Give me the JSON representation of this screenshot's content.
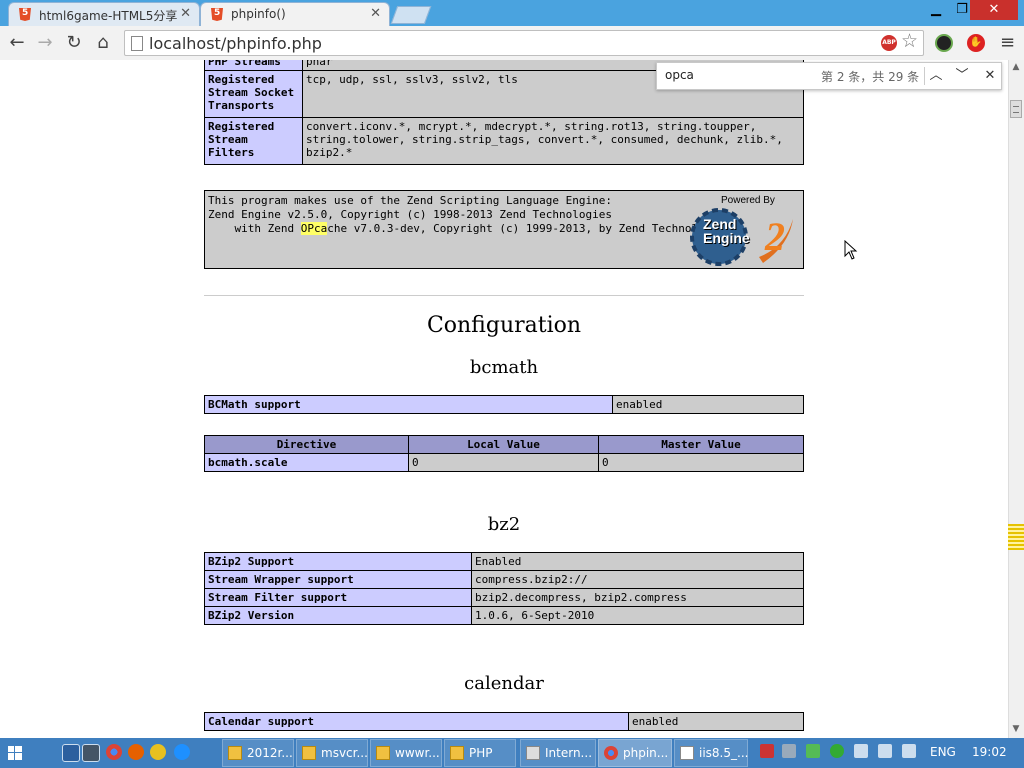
{
  "browser": {
    "tabs": [
      {
        "label": "html6game-HTML5分享",
        "active": false
      },
      {
        "label": "phpinfo()",
        "active": true
      }
    ],
    "url": "localhost/phpinfo.php"
  },
  "findbar": {
    "query": "opca",
    "count": "第 2 条，共 29 条"
  },
  "phpinfo": {
    "top_table": [
      {
        "key": "PHP Streams",
        "value": "phar"
      },
      {
        "key": "Registered Stream Socket Transports",
        "value": "tcp, udp, ssl, sslv3, sslv2, tls"
      },
      {
        "key": "Registered Stream Filters",
        "value": "convert.iconv.*, mcrypt.*, mdecrypt.*, string.rot13, string.toupper, string.tolower, string.strip_tags, convert.*, consumed, dechunk, zlib.*, bzip2.*"
      }
    ],
    "zend": {
      "line1": "This program makes use of the Zend Scripting Language Engine:",
      "line2": "Zend Engine v2.5.0, Copyright (c) 1998-2013 Zend Technologies",
      "line3_pre": "    with Zend ",
      "line3_hl": "OPca",
      "line3_post": "che v7.0.3-dev, Copyright (c) 1999-2013, by Zend Technologies",
      "powered_by": "Powered By",
      "logo_text": "Zend Engine",
      "logo_num": "2"
    },
    "configuration_title": "Configuration",
    "bcmath": {
      "title": "bcmath",
      "support_key": "BCMath support",
      "support_value": "enabled",
      "headers": [
        "Directive",
        "Local Value",
        "Master Value"
      ],
      "directive": {
        "name": "bcmath.scale",
        "local": "0",
        "master": "0"
      }
    },
    "bz2": {
      "title": "bz2",
      "rows": [
        {
          "key": "BZip2 Support",
          "value": "Enabled"
        },
        {
          "key": "Stream Wrapper support",
          "value": "compress.bzip2://"
        },
        {
          "key": "Stream Filter support",
          "value": "bzip2.decompress, bzip2.compress"
        },
        {
          "key": "BZip2 Version",
          "value": "1.0.6, 6-Sept-2010"
        }
      ]
    },
    "calendar": {
      "title": "calendar",
      "support_key": "Calendar support",
      "support_value": "enabled"
    }
  },
  "taskbar": {
    "items": [
      "2012r...",
      "msvcr...",
      "wwwr...",
      "PHP",
      "Intern...",
      "phpin...",
      "iis8.5_..."
    ],
    "lang": "ENG",
    "clock": "19:02"
  }
}
